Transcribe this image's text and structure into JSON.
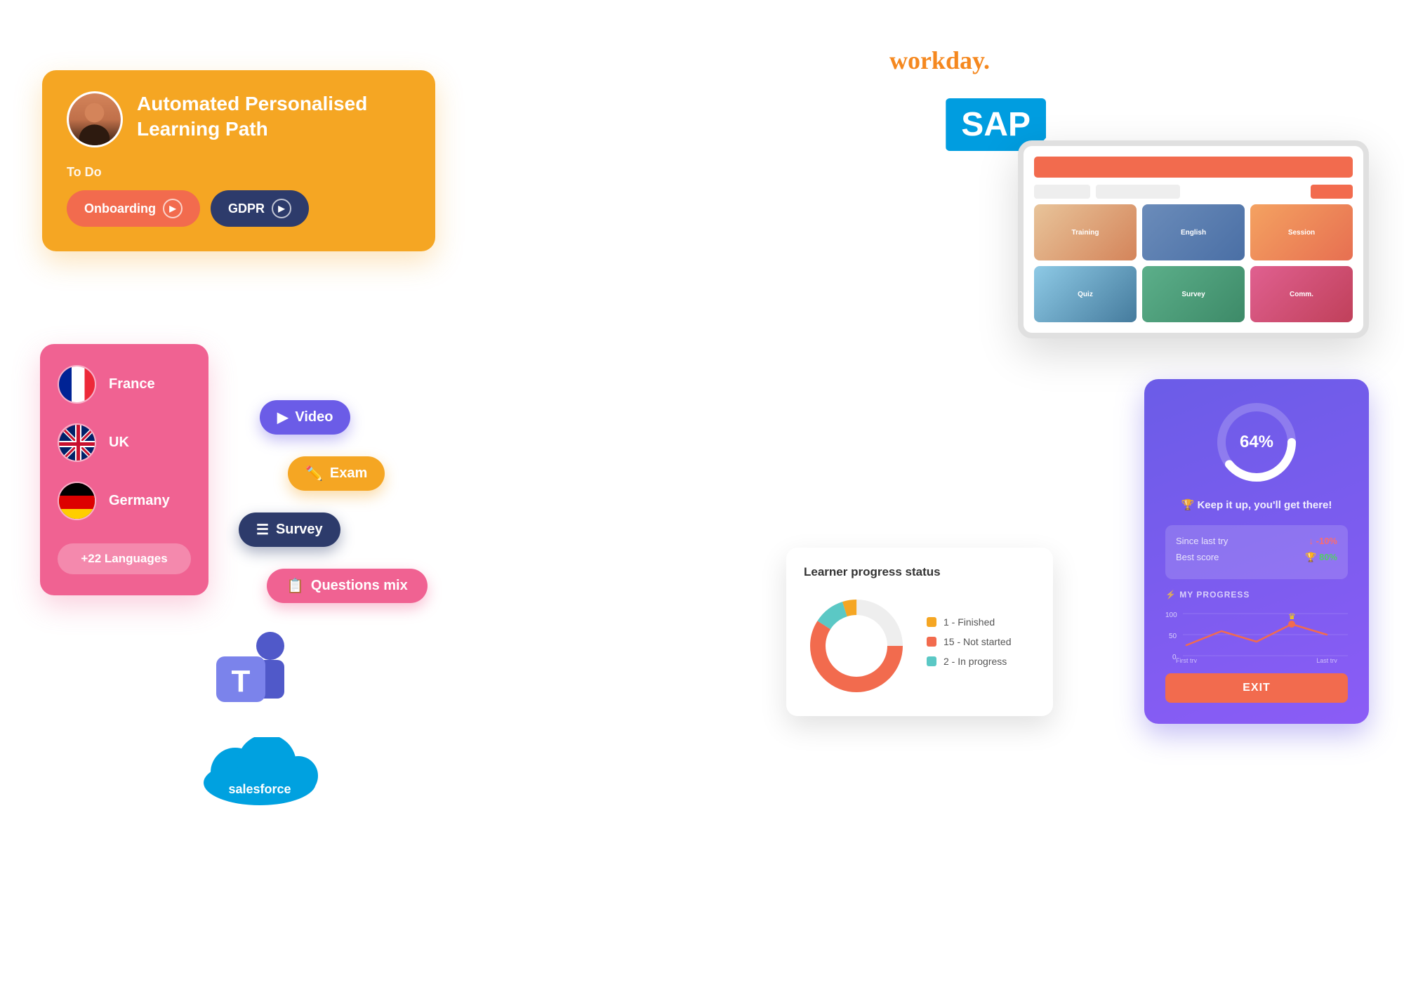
{
  "learning_path_card": {
    "title": "Automated Personalised Learning Path",
    "todo_label": "To Do",
    "btn_onboarding": "Onboarding",
    "btn_gdpr": "GDPR"
  },
  "languages_card": {
    "countries": [
      {
        "name": "France",
        "flag": "france"
      },
      {
        "name": "UK",
        "flag": "uk"
      },
      {
        "name": "Germany",
        "flag": "germany"
      }
    ],
    "more_label": "+22 Languages"
  },
  "content_types": {
    "video": "Video",
    "exam": "Exam",
    "survey": "Survey",
    "questions_mix": "Questions mix"
  },
  "integrations": {
    "workday": "workday.",
    "sap": "SAP",
    "teams": "Microsoft Teams",
    "salesforce": "salesforce"
  },
  "donut_card": {
    "title": "Learner progress status",
    "legend": [
      {
        "count": "1",
        "label": "Finished",
        "color": "#F5A623"
      },
      {
        "count": "15",
        "label": "Not started",
        "color": "#F26B4E"
      },
      {
        "count": "2",
        "label": "In progress",
        "color": "#5BC8C5"
      }
    ]
  },
  "circle_progress_card": {
    "percent": "64%",
    "motivate": "🏆 Keep it up, you'll get there!",
    "since_last_try_label": "Since last try",
    "since_last_try_value": "↓ -10%",
    "best_score_label": "Best score",
    "best_score_value": "🏆 80%",
    "my_progress_label": "MY PROGRESS",
    "exit_label": "EXIT"
  }
}
